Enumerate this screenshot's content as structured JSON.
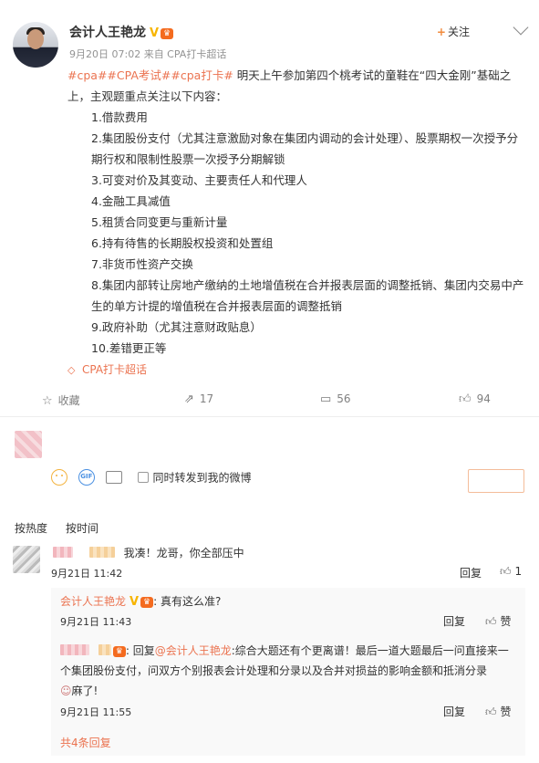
{
  "post": {
    "author": "会计人王艳龙",
    "meta": "9月20日 07:02 来自 CPA打卡超话",
    "follow_label": "关注",
    "tags": "#cpa##CPA考试##cpa打卡#",
    "intro": " 明天上午参加第四个桃考试的童鞋在“四大金刚”基础之上，主观题重点关注以下内容：",
    "items": [
      "1.借款费用",
      "2.集团股份支付（尤其注意激励对象在集团内调动的会计处理）、股票期权一次授予分期行权和限制性股票一次授予分期解锁",
      "3.可变对价及其变动、主要责任人和代理人",
      "4.金融工具减值",
      "5.租赁合同变更与重新计量",
      "6.持有待售的长期股权投资和处置组",
      "7.非货币性资产交换",
      "8.集团内部转让房地产缴纳的土地增值税在合并报表层面的调整抵销、集团内交易中产生的单方计提的增值税在合并报表层面的调整抵销",
      "9.政府补助（尤其注意财政贴息）",
      "10.差错更正等"
    ],
    "supertopic": "CPA打卡超话",
    "actions": {
      "favorite": "收藏",
      "repost": "17",
      "comment": "56",
      "like": "94"
    }
  },
  "comment_box": {
    "repost_label": "同时转发到我的微博"
  },
  "sort": {
    "hot": "按热度",
    "time": "按时间"
  },
  "comments": [
    {
      "text": "我凑！龙哥，你全部压中",
      "time": "9月21日 11:42",
      "reply": "回复",
      "likes": "1"
    }
  ],
  "replies": [
    {
      "name": "会计人王艳龙",
      "text": "真有这么准?",
      "time": "9月21日 11:43",
      "reply": "回复",
      "like": "赞"
    },
    {
      "prefix": "回复",
      "mention": "@会计人王艳龙",
      "text": ":综合大题还有个更离谱！最后一道大题最后一问直接来一个集团股份支付，问双方个别报表会计处理和分录以及合并对损益的影响金额和抵消分录",
      "tail": "麻了!",
      "time": "9月21日 11:55",
      "reply": "回复",
      "like": "赞"
    }
  ],
  "more_replies": "共4条回复",
  "colors": {
    "accent": "#eb7350",
    "vip": "#f7b500"
  }
}
